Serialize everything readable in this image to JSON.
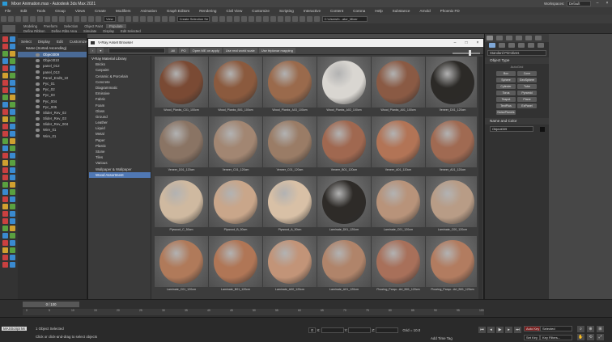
{
  "window": {
    "title": "Mixer Animation.max - Autodesk 3ds Max 2021",
    "workspace_label": "Workspaces:",
    "workspace_value": "Default"
  },
  "menu": [
    "File",
    "Edit",
    "Tools",
    "Group",
    "Views",
    "Create",
    "Modifiers",
    "Animation",
    "Graph Editors",
    "Rendering",
    "Civil View",
    "Customize",
    "Scripting",
    "Interactive",
    "Content",
    "Corona",
    "Help",
    "Substance",
    "Arnold",
    "Phoenix FD"
  ],
  "toolbar": {
    "view_value": "View",
    "selection_set": "Create Selection Se",
    "path": "C:\\Users\\h...ator_Mixer"
  },
  "ribbon": {
    "row1": [
      "Modeling",
      "Freeform",
      "Selection",
      "Object Paint",
      "Populate"
    ],
    "row2": [
      "Define Ribbon",
      "Define Ribs Area",
      "Simulate",
      "Display",
      "Edit Selected"
    ]
  },
  "explorer": {
    "tabs": [
      "Select",
      "Display",
      "Edit",
      "Customize"
    ],
    "header": "Name (Sorted Ascending)",
    "objects": [
      {
        "name": "Object009",
        "selected": true
      },
      {
        "name": "Object010",
        "selected": false
      },
      {
        "name": "panel_012",
        "selected": false
      },
      {
        "name": "panel_013",
        "selected": false
      },
      {
        "name": "Panel_End5_10",
        "selected": false
      },
      {
        "name": "Pyc_01",
        "selected": false
      },
      {
        "name": "Pyc_02",
        "selected": false
      },
      {
        "name": "Pyc_03",
        "selected": false
      },
      {
        "name": "Pyc_004",
        "selected": false
      },
      {
        "name": "Pyc_005",
        "selected": false
      },
      {
        "name": "Slider_Rev_02",
        "selected": false
      },
      {
        "name": "Slider_Rev_03",
        "selected": false
      },
      {
        "name": "Slider_Rev_004",
        "selected": false
      },
      {
        "name": "Wire_01",
        "selected": false
      },
      {
        "name": "Wire_01",
        "selected": false
      }
    ]
  },
  "asset_browser": {
    "title": "V-Ray Asset Browser",
    "toolbar": [
      "All",
      "PO",
      "Open ME on apply",
      "Use real world scale",
      "Use triplanar mapping"
    ],
    "tree_root": "V-Ray Material Library",
    "tree": [
      "Bricks",
      "Carpaint",
      "Ceramic & Porcelain",
      "Concrete",
      "Diagrammatic",
      "Emissive",
      "Fabric",
      "Foam",
      "Glass",
      "Ground",
      "Leather",
      "Liquid",
      "Metal",
      "Paper",
      "Plastic",
      "Stone",
      "Tiles",
      "Various",
      "Wallpaper & Wallpaper",
      "Wood Assortment"
    ],
    "tree_selected": "Wood Assortment",
    "materials": [
      {
        "label": "Wood_Planks_C01_100cm",
        "color": "#7a4a34"
      },
      {
        "label": "Wood_Planks_B01_100cm",
        "color": "#8b5a3e"
      },
      {
        "label": "Wood_Planks_A03_100cm",
        "color": "#9a6a4c"
      },
      {
        "label": "Wood_Planks_A02_100cm",
        "color": "#d9d6d1"
      },
      {
        "label": "Wood_Planks_A01_100cm",
        "color": "#8a5a44"
      },
      {
        "label": "Veneer_D01_120cm",
        "color": "#2c2a27"
      },
      {
        "label": "Veneer_D01_120cm",
        "color": "#8a7464"
      },
      {
        "label": "Veneer_C01_120cm",
        "color": "#a28672"
      },
      {
        "label": "Veneer_C01_120cm",
        "color": "#9a7c66"
      },
      {
        "label": "Veneer_B01_120cm",
        "color": "#a06850"
      },
      {
        "label": "Veneer_A01_120cm",
        "color": "#b27456"
      },
      {
        "label": "Veneer_A01_120cm",
        "color": "#a06a52"
      },
      {
        "label": "Plywood_C_50cm",
        "color": "#cfb9a0"
      },
      {
        "label": "Plywood_B_50cm",
        "color": "#c9a68a"
      },
      {
        "label": "Plywood_A_50cm",
        "color": "#d8c0a6"
      },
      {
        "label": "Laminate_D01_120cm",
        "color": "#2e2b28"
      },
      {
        "label": "Laminate_C01_120cm",
        "color": "#b8937a"
      },
      {
        "label": "Laminate_C00_120cm",
        "color": "#b89c86"
      },
      {
        "label": "Laminate_C01_120cm",
        "color": "#b07a5a"
      },
      {
        "label": "Laminate_B01_120cm",
        "color": "#b07656"
      },
      {
        "label": "Laminate_A00_120cm",
        "color": "#c29478"
      },
      {
        "label": "Laminate_A01_120cm",
        "color": "#b0846a"
      },
      {
        "label": "Flooring_Parqu...Art_B01_120cm",
        "color": "#a8705a"
      },
      {
        "label": "Flooring_Parqu...Art_B01_120cm",
        "color": "#b27c60"
      }
    ]
  },
  "command_panel": {
    "dropdown": "Standard Primitives",
    "object_type_header": "Object Type",
    "autogrid": "AutoGrid",
    "buttons": [
      "Box",
      "Cone",
      "Sphere",
      "GeoSphere",
      "Cylinder",
      "Tube",
      "Torus",
      "Pyramid",
      "Teapot",
      "Plane",
      "TextPlus",
      "ExPanel",
      "NoisePlanets"
    ],
    "name_color_header": "Name and Color",
    "name_value": "Object009"
  },
  "timeline": {
    "slider": "0 / 100",
    "ticks": [
      "0",
      "5",
      "10",
      "15",
      "20",
      "25",
      "30",
      "35",
      "40",
      "45",
      "50",
      "55",
      "60",
      "65",
      "70",
      "75",
      "80",
      "85",
      "90",
      "95",
      "100"
    ]
  },
  "status": {
    "maxscript": "MAXScript Mi",
    "selection": "1 Object Selected",
    "prompt": "Click or click-and-drag to select objects",
    "x_label": "X:",
    "y_label": "Y:",
    "z_label": "Z:",
    "grid": "Grid = 10.0",
    "add_time_tag": "Add Time Tag",
    "auto_key": "Auto Key",
    "selected": "Selected",
    "set_key": "Set Key",
    "key_filters": "Key Filters..."
  }
}
